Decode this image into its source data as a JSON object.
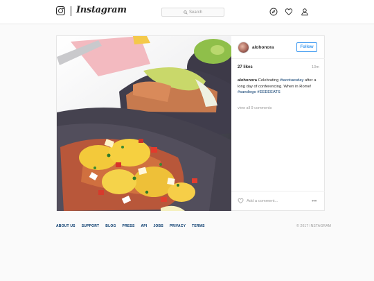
{
  "brand": {
    "name": "Instagram"
  },
  "search": {
    "placeholder": "Search"
  },
  "nav": {
    "icons": [
      "compass-icon",
      "heart-icon",
      "person-icon"
    ]
  },
  "post": {
    "username": "alohonora",
    "follow_label": "Follow",
    "likes": "27 likes",
    "time": "13m",
    "caption": {
      "user": "alohonora",
      "pre": " Celebrating ",
      "tag1": "#tacotuesday",
      "mid": " after a long day of conferencing. When in Rome! ",
      "tag2": "#sandiego",
      "sep": " ",
      "tag3": "#EEEEEATS"
    },
    "view_all": "view all 9 comments",
    "add_comment_placeholder": "Add a comment...",
    "more": "•••"
  },
  "footer": {
    "links": [
      "ABOUT US",
      "SUPPORT",
      "BLOG",
      "PRESS",
      "API",
      "JOBS",
      "PRIVACY",
      "TERMS"
    ],
    "copyright": "© 2017 INSTAGRAM"
  },
  "colors": {
    "accent": "#3897f0",
    "hashtag": "#003569",
    "muted": "#999999",
    "border": "#e6e6e6"
  }
}
